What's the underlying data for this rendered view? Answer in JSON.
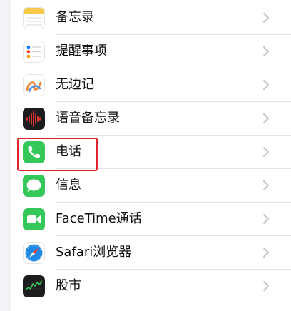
{
  "settings": {
    "items": [
      {
        "label": "备忘录",
        "icon": "notes-icon"
      },
      {
        "label": "提醒事项",
        "icon": "reminders-icon"
      },
      {
        "label": "无边记",
        "icon": "freeform-icon"
      },
      {
        "label": "语音备忘录",
        "icon": "voice-memos-icon"
      },
      {
        "label": "电话",
        "icon": "phone-icon"
      },
      {
        "label": "信息",
        "icon": "messages-icon"
      },
      {
        "label": "FaceTime通话",
        "icon": "facetime-icon"
      },
      {
        "label": "Safari浏览器",
        "icon": "safari-icon"
      },
      {
        "label": "股市",
        "icon": "stocks-icon"
      }
    ]
  },
  "colors": {
    "highlight": "#e0262a",
    "phone_green": "#34c759",
    "facetime_green": "#34c759",
    "messages_green": "#34c759",
    "safari_blue": "#1e88e5"
  }
}
